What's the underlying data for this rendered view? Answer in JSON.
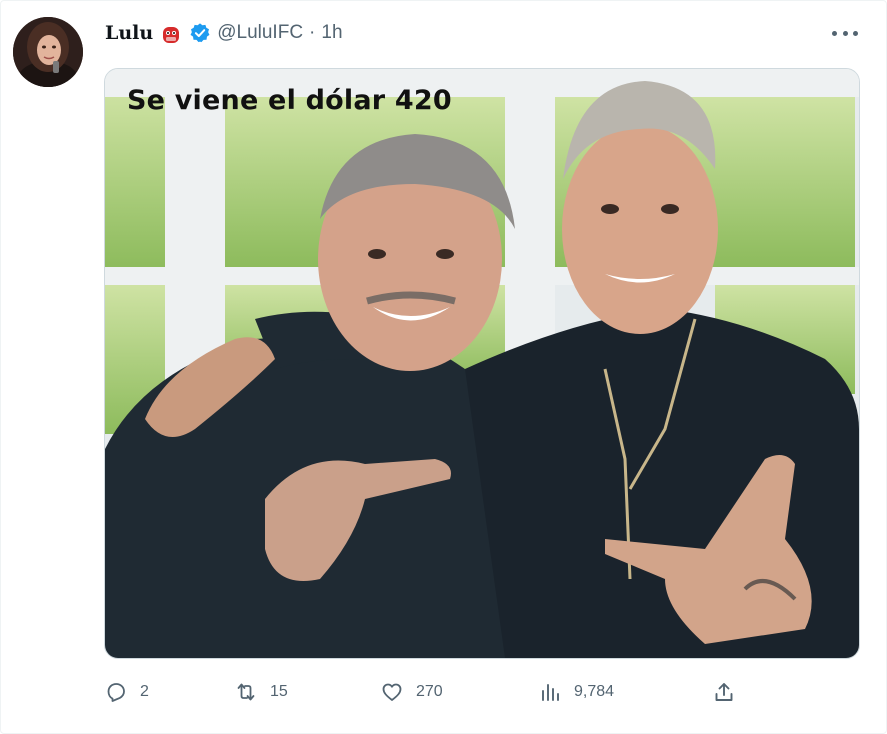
{
  "tweet": {
    "display_name": "Lulu",
    "name_emoji": "ogre-mask",
    "verified": true,
    "handle": "@LuluIFC",
    "separator": "·",
    "time": "1h",
    "media_caption": "Se viene el dólar 420",
    "actions": {
      "replies": "2",
      "retweets": "15",
      "likes": "270",
      "views": "9,784"
    }
  },
  "icons": [
    "more-icon",
    "reply-icon",
    "retweet-icon",
    "like-icon",
    "views-icon",
    "share-icon",
    "verified-badge-icon"
  ],
  "colors": {
    "accent": "#1d9bf0",
    "muted": "#536471",
    "text": "#0f1419",
    "emoji_red": "#d62b2b"
  }
}
